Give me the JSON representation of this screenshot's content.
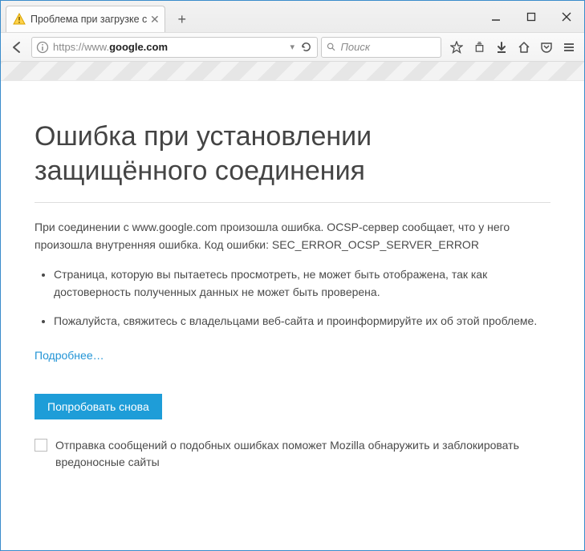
{
  "tab": {
    "title": "Проблема при загрузке стр"
  },
  "url": {
    "prefix": "https://www.",
    "host": "google.com"
  },
  "search": {
    "placeholder": "Поиск"
  },
  "page": {
    "heading": "Ошибка при установлении защищённого соединения",
    "paragraph": "При соединении с www.google.com произошла ошибка. OCSP-сервер сообщает, что у него произошла внутренняя ошибка. Код ошибки: SEC_ERROR_OCSP_SERVER_ERROR",
    "bullets": [
      "Страница, которую вы пытаетесь просмотреть, не может быть отображена, так как достоверность полученных данных не может быть проверена.",
      "Пожалуйста, свяжитесь с владельцами веб-сайта и проинформируйте их об этой проблеме."
    ],
    "learn_more": "Подробнее…",
    "retry": "Попробовать снова",
    "report": "Отправка сообщений о подобных ошибках поможет Mozilla обнаружить и заблокировать вредоносные сайты"
  }
}
